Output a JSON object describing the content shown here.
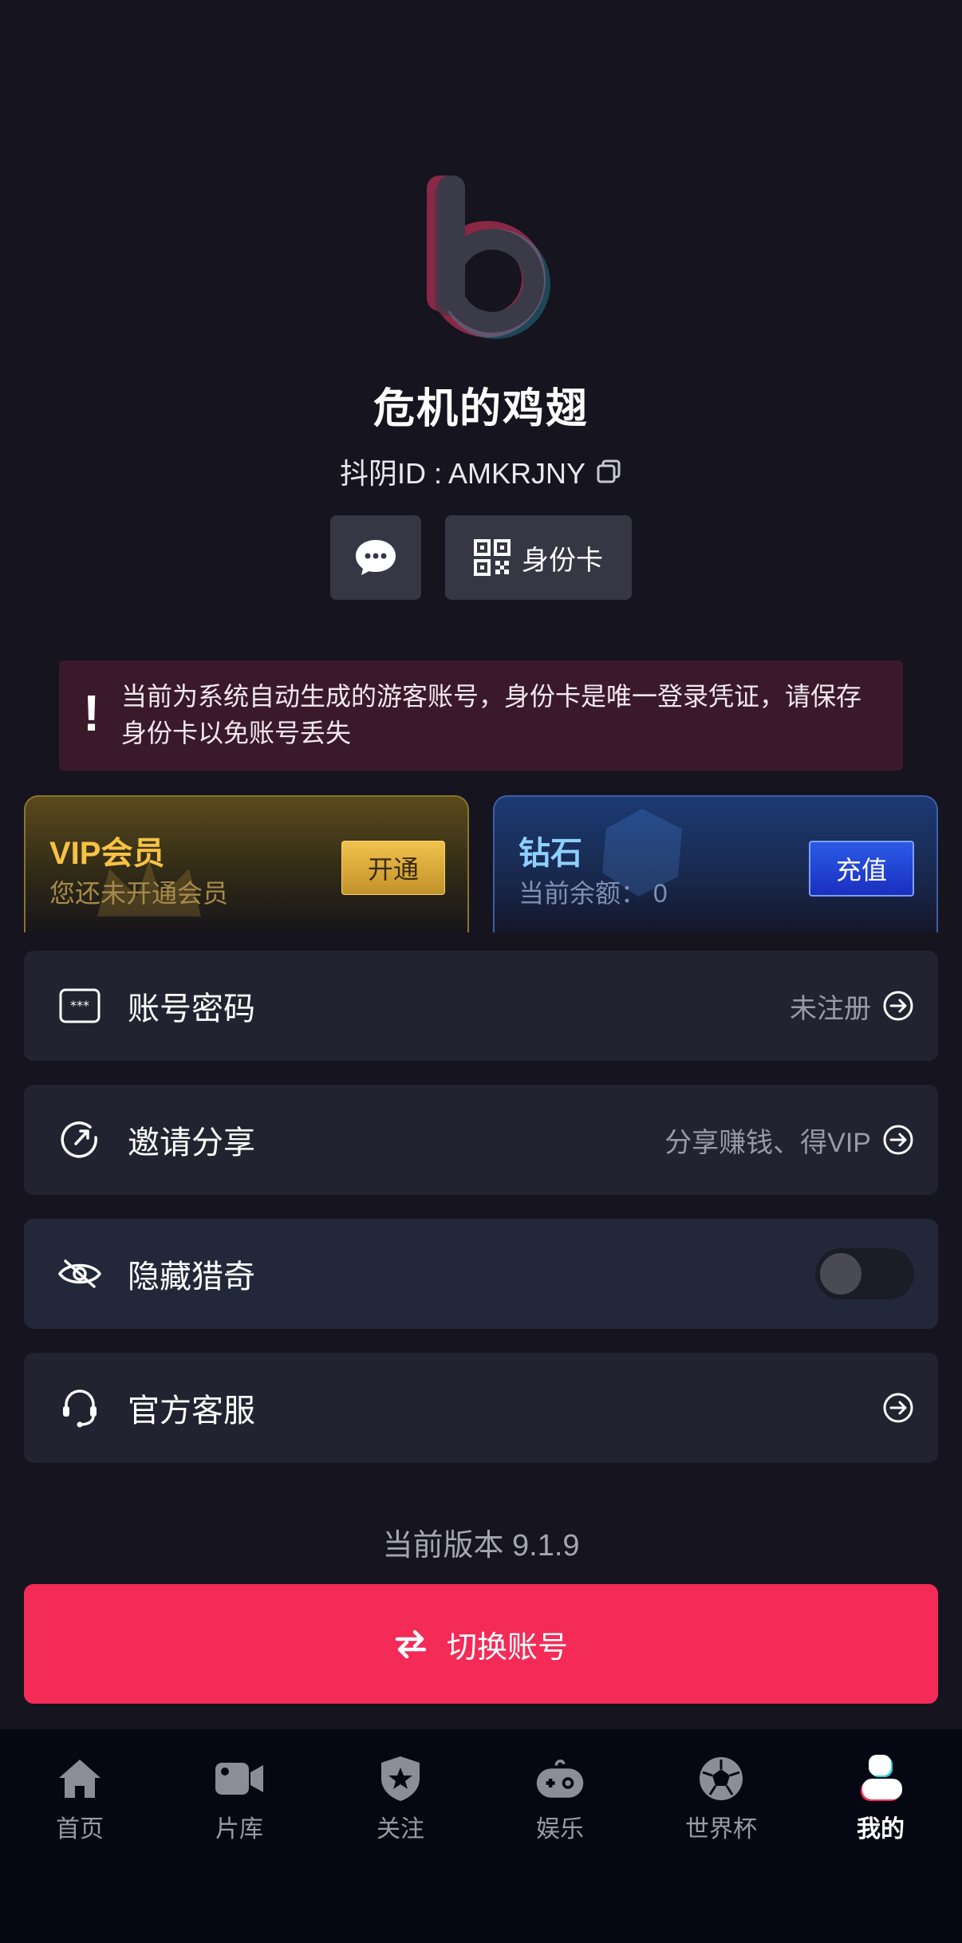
{
  "profile": {
    "username": "危机的鸡翅",
    "id_label": "抖阴ID : AMKRJNY",
    "idcard_label": "身份卡"
  },
  "notice": {
    "text": "当前为系统自动生成的游客账号，身份卡是唯一登录凭证，请保存身份卡以免账号丢失"
  },
  "vip_card": {
    "title": "VIP会员",
    "subtitle": "您还未开通会员",
    "button": "开通"
  },
  "diamond_card": {
    "title": "钻石",
    "subtitle": "当前余额： 0",
    "button": "充值"
  },
  "menu": [
    {
      "label": "账号密码",
      "right": "未注册",
      "icon": "password-icon"
    },
    {
      "label": "邀请分享",
      "right": "分享赚钱、得VIP",
      "icon": "share-icon"
    },
    {
      "label": "隐藏猎奇",
      "right": "",
      "icon": "eye-hidden-icon",
      "toggle": false
    },
    {
      "label": "官方客服",
      "right": "",
      "icon": "headset-icon"
    }
  ],
  "version": "当前版本 9.1.9",
  "switch_account": "切换账号",
  "tabs": [
    {
      "label": "首页",
      "icon": "home-icon"
    },
    {
      "label": "片库",
      "icon": "video-camera-icon"
    },
    {
      "label": "关注",
      "icon": "star-shield-icon"
    },
    {
      "label": "娱乐",
      "icon": "gamepad-icon"
    },
    {
      "label": "世界杯",
      "icon": "soccer-ball-icon"
    },
    {
      "label": "我的",
      "icon": "profile-icon",
      "active": true
    }
  ],
  "colors": {
    "background": "#15141f",
    "accent": "#f42a57",
    "vip_gold": "#f6c244",
    "diamond_blue": "#8fd0ff"
  }
}
